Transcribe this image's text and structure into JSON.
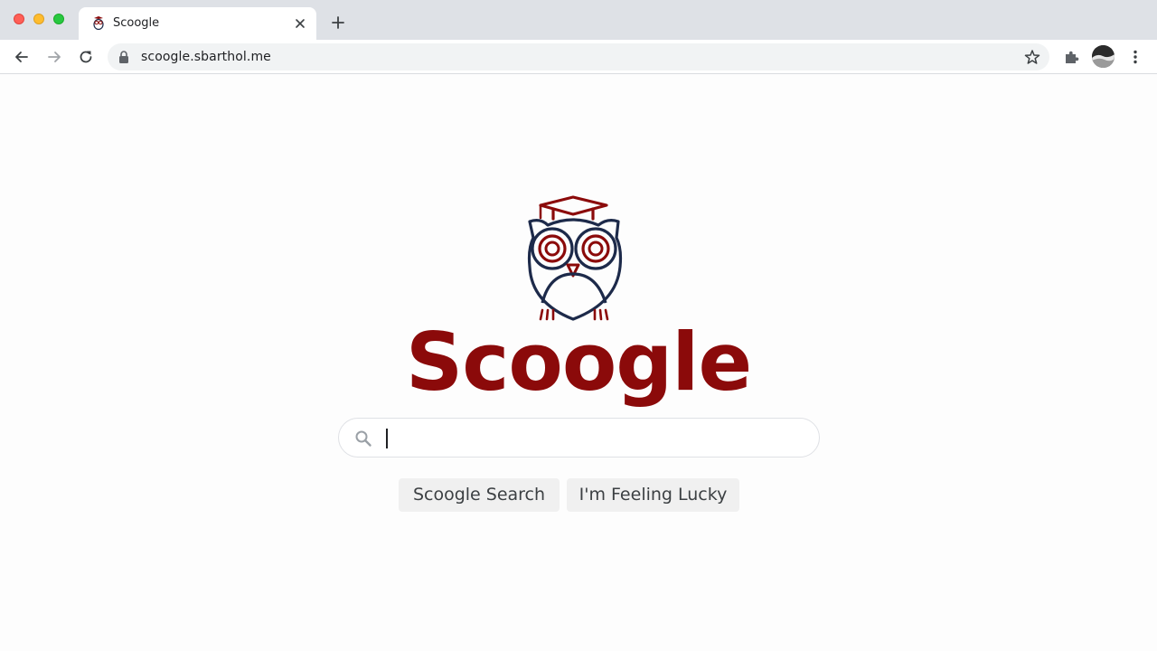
{
  "browser": {
    "tab": {
      "title": "Scoogle",
      "favicon": "owl-favicon"
    },
    "address_bar": {
      "url": "scoogle.sbarthol.me",
      "lock": "lock-icon"
    },
    "icons": [
      "back-icon",
      "forward-icon",
      "reload-icon",
      "star-icon",
      "extensions-icon",
      "avatar",
      "menu-icon"
    ]
  },
  "page": {
    "logo_text": "Scoogle",
    "logo_icon": "owl-graduate-icon",
    "search": {
      "value": "",
      "placeholder": ""
    },
    "buttons": {
      "search_label": "Scoogle Search",
      "lucky_label": "I'm Feeling Lucky"
    }
  },
  "colors": {
    "brand_red": "#8b0a0a",
    "owl_navy": "#1d2a4a",
    "tab_strip": "#dee1e6"
  }
}
